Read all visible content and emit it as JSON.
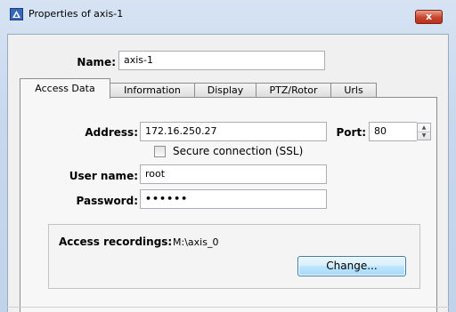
{
  "window": {
    "title": "Properties of axis-1",
    "close_label": "x"
  },
  "header": {
    "name_label": "Name:",
    "name_value": "axis-1"
  },
  "tabs": [
    {
      "label": "Access Data",
      "active": true
    },
    {
      "label": "Information",
      "active": false
    },
    {
      "label": "Display",
      "active": false
    },
    {
      "label": "PTZ/Rotor",
      "active": false
    },
    {
      "label": "Urls",
      "active": false
    }
  ],
  "access_data": {
    "address_label": "Address:",
    "address_value": "172.16.250.27",
    "port_label": "Port:",
    "port_value": "80",
    "ssl_label": "Secure connection (SSL)",
    "ssl_checked": false,
    "username_label": "User name:",
    "username_value": "root",
    "password_label": "Password:",
    "password_value": "••••••"
  },
  "recordings": {
    "label": "Access recordings:",
    "path": "M:\\axis_0",
    "change_button": "Change..."
  },
  "colors": {
    "titlebar": "#c7d8ee",
    "close_button": "#c8452c",
    "button_border": "#3c7fb1"
  }
}
